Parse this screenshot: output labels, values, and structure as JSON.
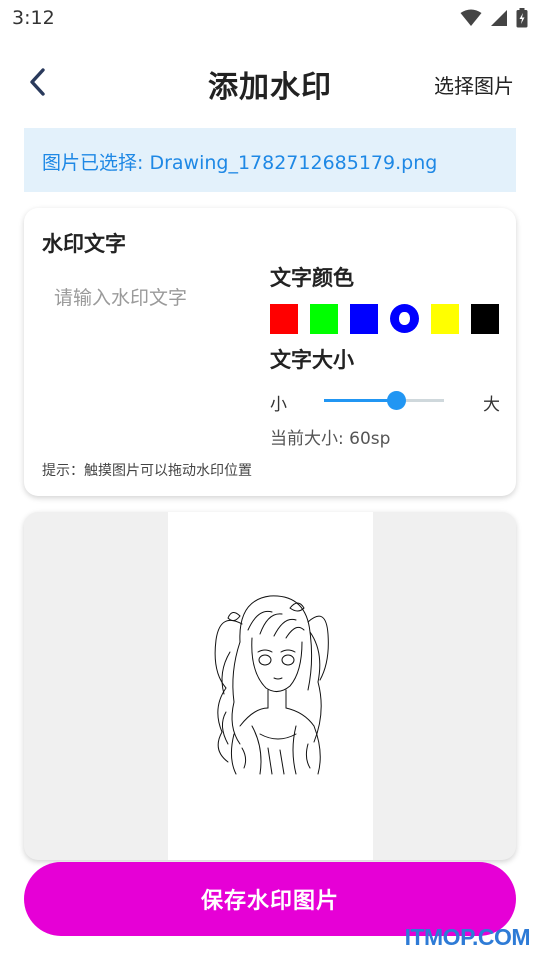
{
  "status_bar": {
    "time": "3:12",
    "icons": [
      "wifi-icon",
      "signal-icon",
      "battery-icon"
    ]
  },
  "app_bar": {
    "back_icon": "chevron-left-icon",
    "title": "添加水印",
    "select_image_label": "选择图片"
  },
  "banner": {
    "text": "图片已选择: Drawing_1782712685179.png",
    "color": "#1e88e5",
    "background": "#e3f1fb"
  },
  "watermark_settings": {
    "title": "水印文字",
    "input_placeholder": "请输入水印文字",
    "input_value": "",
    "color_title": "文字颜色",
    "colors": [
      {
        "name": "red",
        "hex": "#ff0000",
        "selected": false
      },
      {
        "name": "green",
        "hex": "#00ff00",
        "selected": false
      },
      {
        "name": "blue",
        "hex": "#0000ff",
        "selected": false
      },
      {
        "name": "blue-selected",
        "hex": "#0000ff",
        "selected": true
      },
      {
        "name": "yellow",
        "hex": "#ffff00",
        "selected": false
      },
      {
        "name": "black",
        "hex": "#000000",
        "selected": false
      }
    ],
    "size_title": "文字大小",
    "size_min_label": "小",
    "size_max_label": "大",
    "size_level": 0.6,
    "current_size_text": "当前大小: 60sp",
    "hint": "提示：触摸图片可以拖动水印位置"
  },
  "preview": {
    "image_description_icon": "sketch-image"
  },
  "save_button": {
    "label": "保存水印图片",
    "color": "#e600d6"
  },
  "site_watermark": "ITMOP.COM"
}
